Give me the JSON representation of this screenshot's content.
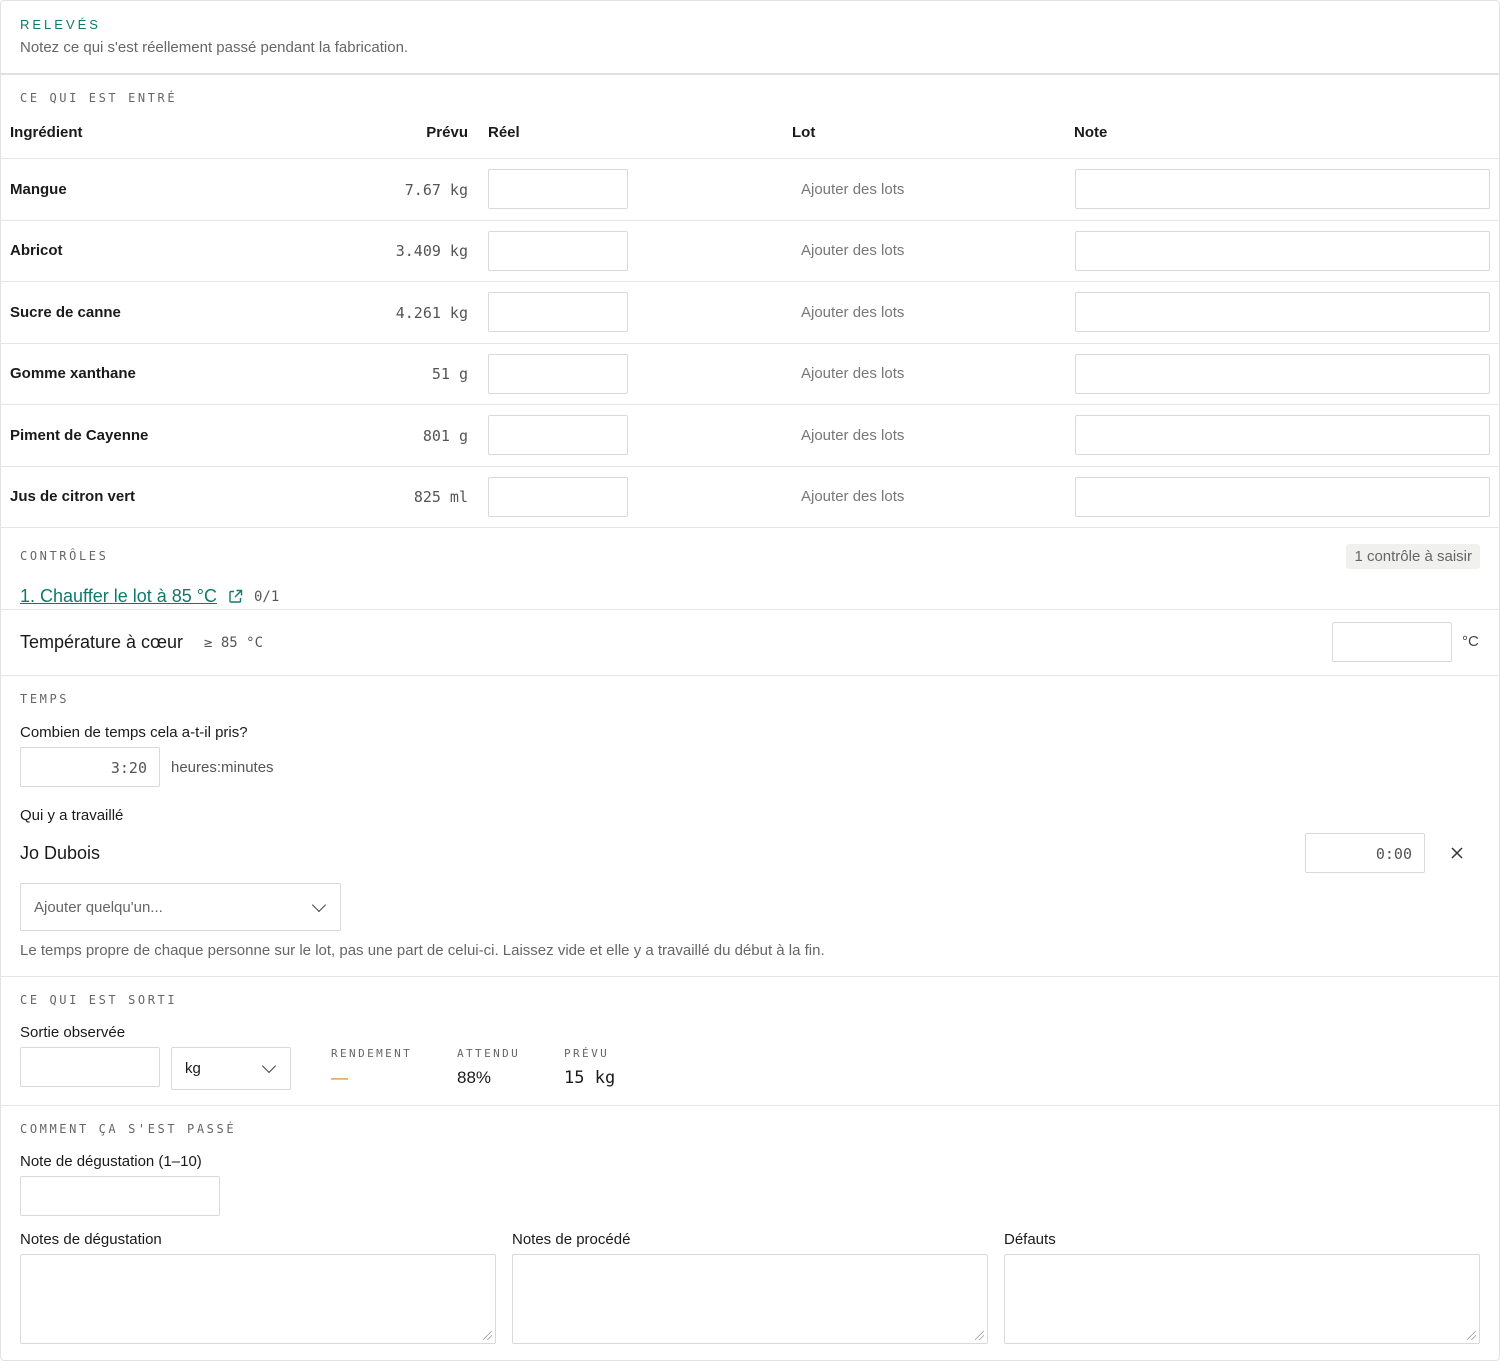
{
  "header": {
    "eyebrow": "RELEVÉS",
    "subtitle": "Notez ce qui s'est réellement passé pendant la fabrication."
  },
  "inputs_section": {
    "eyebrow": "CE QUI EST ENTRÉ",
    "columns": {
      "ingredient": "Ingrédient",
      "planned": "Prévu",
      "actual": "Réel",
      "lot": "Lot",
      "note": "Note"
    },
    "rows": [
      {
        "name": "Mangue",
        "planned": "7.67 kg",
        "lot_action": "Ajouter des lots"
      },
      {
        "name": "Abricot",
        "planned": "3.409 kg",
        "lot_action": "Ajouter des lots"
      },
      {
        "name": "Sucre de canne",
        "planned": "4.261 kg",
        "lot_action": "Ajouter des lots"
      },
      {
        "name": "Gomme xanthane",
        "planned": "51 g",
        "lot_action": "Ajouter des lots"
      },
      {
        "name": "Piment de Cayenne",
        "planned": "801 g",
        "lot_action": "Ajouter des lots"
      },
      {
        "name": "Jus de citron vert",
        "planned": "825 ml",
        "lot_action": "Ajouter des lots"
      }
    ]
  },
  "controls_section": {
    "eyebrow": "CONTRÔLES",
    "badge": "1 contrôle à saisir",
    "step_link": "1. Chauffer le lot à 85 °C",
    "step_progress": "0/1",
    "check_label": "Température à cœur",
    "check_target": "≥ 85 °C",
    "check_unit": "°C"
  },
  "time_section": {
    "eyebrow": "TEMPS",
    "duration_question": "Combien de temps cela a-t-il pris?",
    "duration_value": "3:20",
    "duration_unit": "heures:minutes",
    "workers_label": "Qui y a travaillé",
    "workers": [
      {
        "name": "Jo Dubois",
        "time": "0:00"
      }
    ],
    "add_person_placeholder": "Ajouter quelqu'un...",
    "help_text": "Le temps propre de chaque personne sur le lot, pas une part de celui-ci. Laissez vide et elle y a travaillé du début à la fin."
  },
  "output_section": {
    "eyebrow": "CE QUI EST SORTI",
    "observed_label": "Sortie observée",
    "unit_selected": "kg",
    "yield_label": "RENDEMENT",
    "yield_value": "—",
    "expected_label": "ATTENDU",
    "expected_value": "88%",
    "planned_label": "PRÉVU",
    "planned_value": "15 kg"
  },
  "notes_section": {
    "eyebrow": "COMMENT ÇA S'EST PASSÉ",
    "score_label": "Note de dégustation (1–10)",
    "tasting_notes_label": "Notes de dégustation",
    "process_notes_label": "Notes de procédé",
    "defects_label": "Défauts"
  },
  "colors": {
    "accent": "#0f7a6a",
    "warning": "#d08a1a",
    "border": "#d9d9d9",
    "muted": "#666666"
  }
}
